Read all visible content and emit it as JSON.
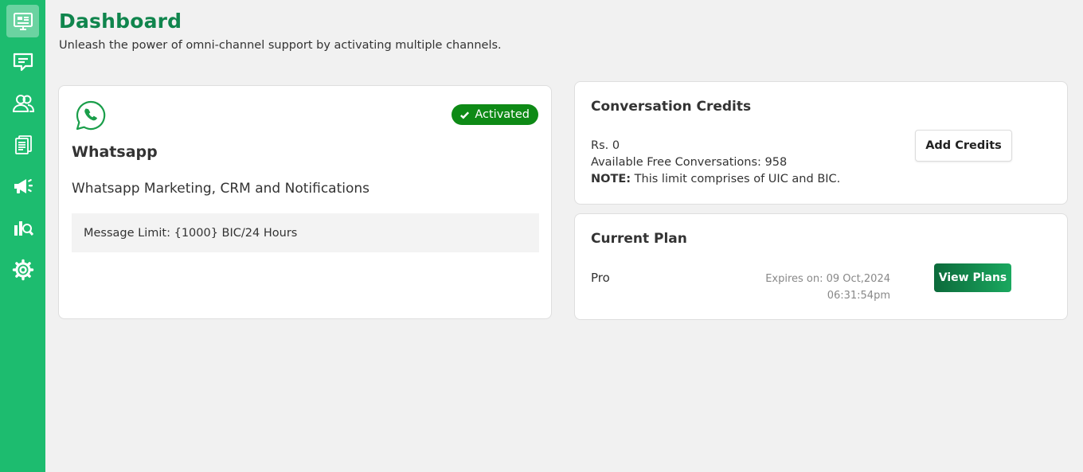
{
  "sidebar": {
    "items": [
      {
        "icon": "dashboard-icon",
        "active": true
      },
      {
        "icon": "chat-icon",
        "active": false
      },
      {
        "icon": "contacts-icon",
        "active": false
      },
      {
        "icon": "templates-icon",
        "active": false
      },
      {
        "icon": "campaign-icon",
        "active": false
      },
      {
        "icon": "reports-icon",
        "active": false
      },
      {
        "icon": "settings-icon",
        "active": false
      }
    ]
  },
  "header": {
    "title": "Dashboard",
    "subtitle": "Unleash the power of omni-channel support by activating multiple channels."
  },
  "whatsapp_card": {
    "icon": "whatsapp-icon",
    "status": "Activated",
    "title": "Whatsapp",
    "description": "Whatsapp Marketing, CRM and Notifications",
    "message_limit": "Message Limit: {1000} BIC/24 Hours"
  },
  "credits_card": {
    "title": "Conversation Credits",
    "balance": "Rs. 0",
    "free_conversations": "Available Free Conversations: 958",
    "note_label": "NOTE:",
    "note_text": " This limit comprises of UIC and BIC.",
    "add_button": "Add Credits"
  },
  "plan_card": {
    "title": "Current Plan",
    "plan_name": "Pro",
    "expires_line1": "Expires on: 09 Oct,2024",
    "expires_line2": "06:31:54pm",
    "view_button": "View Plans"
  },
  "colors": {
    "sidebar": "#1dbc6f",
    "title": "#10854d",
    "badge": "#0e8a16",
    "whatsapp_icon": "#1a9e4a"
  }
}
